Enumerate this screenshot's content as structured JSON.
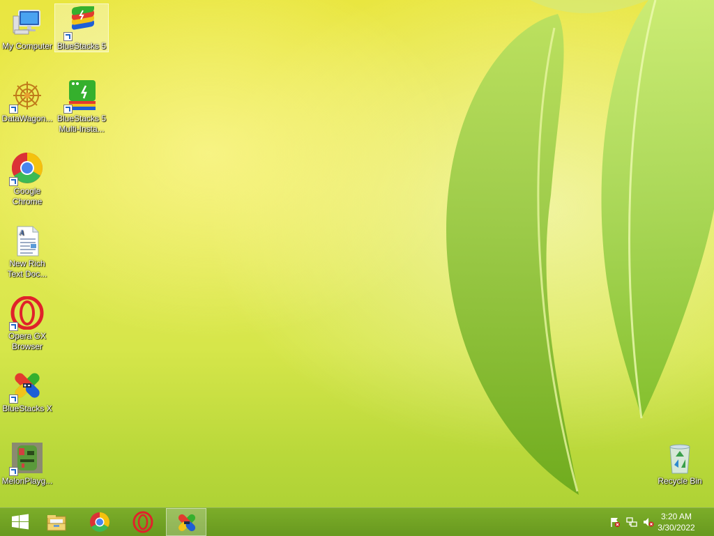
{
  "desktop": {
    "icons": [
      {
        "id": "my-computer",
        "label": "My Computer"
      },
      {
        "id": "bluestacks-5",
        "label": "BlueStacks 5"
      },
      {
        "id": "datawagon",
        "label": "DataWagon..."
      },
      {
        "id": "bluestacks-multi",
        "label": "BlueStacks 5\nMulti-Insta..."
      },
      {
        "id": "google-chrome",
        "label": "Google\nChrome"
      },
      {
        "id": "new-rich-text",
        "label": "New Rich\nText Doc..."
      },
      {
        "id": "opera-gx",
        "label": "Opera GX\nBrowser"
      },
      {
        "id": "bluestacks-x",
        "label": "BlueStacks X"
      },
      {
        "id": "melon-playground",
        "label": "MelonPlayg..."
      },
      {
        "id": "recycle-bin",
        "label": "Recycle Bin"
      }
    ]
  },
  "taskbar": {
    "buttons": [
      "start-icon",
      "file-explorer-icon",
      "chrome-icon",
      "opera-gx-icon",
      "bluestacks-x-icon"
    ],
    "active_button": "bluestacks-x-icon",
    "tray_icons": [
      "action-center-flag-icon",
      "network-icon",
      "volume-muted-icon"
    ],
    "clock": {
      "time": "3:20 AM",
      "date": "3/30/2022"
    }
  },
  "colors": {
    "wallpaper": "#e7ea55",
    "leaf": "#8cc43a",
    "taskbar": "#78aa28"
  }
}
